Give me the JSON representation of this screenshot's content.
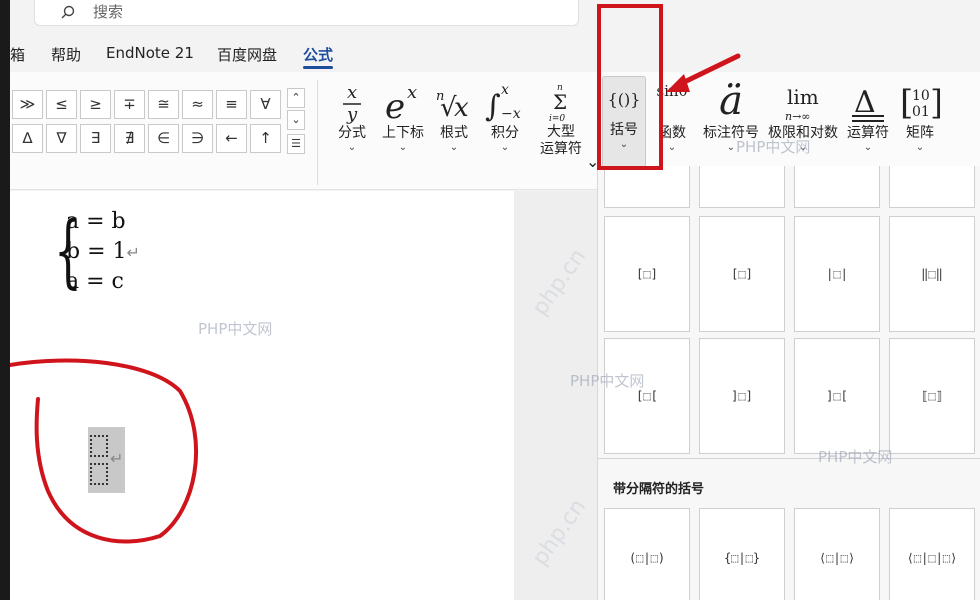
{
  "search": {
    "placeholder": "搜索"
  },
  "tabs": [
    {
      "label": "箱"
    },
    {
      "label": "帮助"
    },
    {
      "label": "EndNote 21"
    },
    {
      "label": "百度网盘"
    },
    {
      "label": "公式"
    }
  ],
  "symbols": {
    "row1": [
      "≫",
      "≤",
      "≥",
      "∓",
      "≅",
      "≈",
      "≡",
      "∀"
    ],
    "row2": [
      "∆",
      "∇",
      "∃",
      "∄",
      "∈",
      "∋",
      "←",
      "↑"
    ]
  },
  "structures": [
    {
      "glyph": "x/y",
      "label": "分式"
    },
    {
      "glyph": "eˣ",
      "label": "上下标"
    },
    {
      "glyph": "ⁿ√x",
      "label": "根式"
    },
    {
      "glyph": "∫x",
      "label": "积分"
    },
    {
      "glyph": "Σ",
      "label": "大型\n运算符"
    },
    {
      "glyph": "{()}",
      "label": "括号"
    },
    {
      "glyph": "sinθ",
      "label": "函数"
    },
    {
      "glyph": "ä",
      "label": "标注符号"
    },
    {
      "glyph": "lim",
      "label": "极限和对数"
    },
    {
      "glyph": "Δ",
      "label": "运算符"
    },
    {
      "glyph": "[10;01]",
      "label": "矩阵"
    }
  ],
  "document": {
    "equation_lines": [
      "a = b",
      "b = 1",
      "a = c"
    ]
  },
  "gallery": {
    "row_a": [
      "[⬚]",
      "[⬚]",
      "|⬚|",
      "‖⬚‖"
    ],
    "row_b": [
      "[⬚[",
      "]⬚]",
      "]⬚[",
      "⟦⬚⟧"
    ],
    "section_title": "带分隔符的括号",
    "row_c": [
      "(⬚|⬚)",
      "{⬚|⬚}",
      "⟨⬚|⬚⟩",
      "⟨⬚|⬚|⬚⟩"
    ]
  },
  "watermark": "PHP中文网",
  "watermark_logo": "php.cn",
  "colors": {
    "accent": "#1f4e9c",
    "annotation_red": "#d0141c"
  }
}
